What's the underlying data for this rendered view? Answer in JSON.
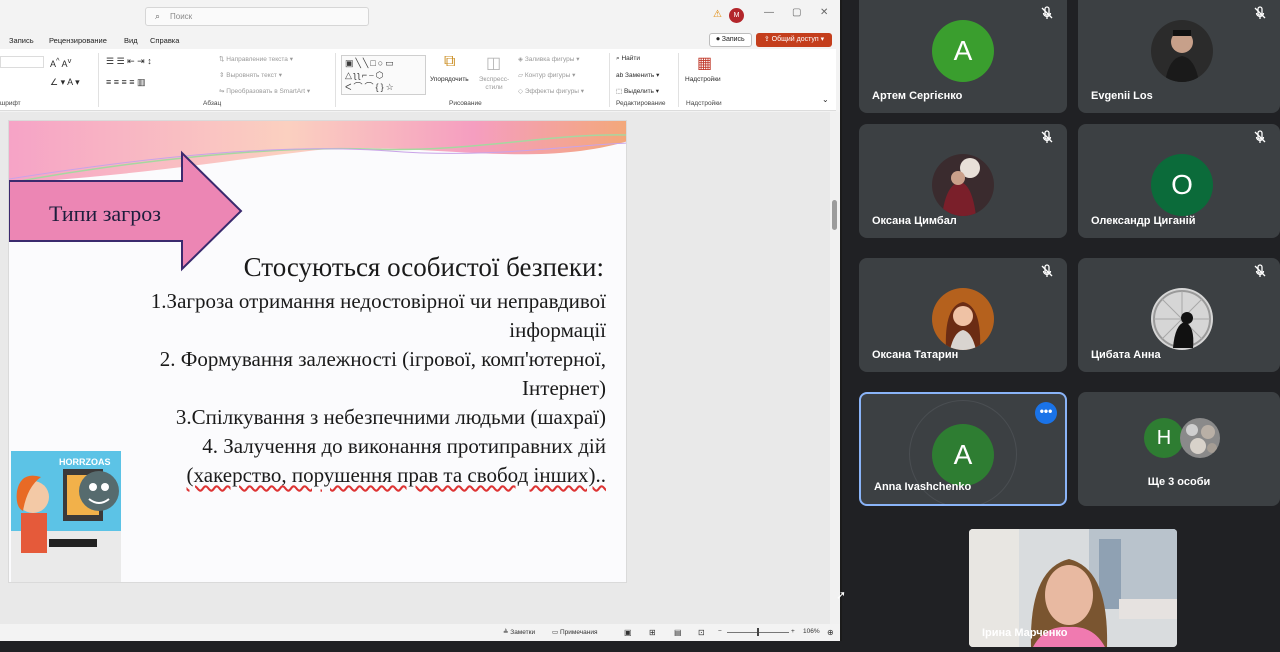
{
  "ppt": {
    "search_placeholder": "Поиск",
    "user_initial": "M",
    "menu": [
      "Запись",
      "Рецензирование",
      "Вид",
      "Справка"
    ],
    "record_button": "Запись",
    "share_button": "Общий доступ",
    "ribbon": {
      "text_direction": "Направление текста",
      "align_text": "Выровнять текст",
      "smartart": "Преобразовать в SmartArt",
      "paragraph_group": "Абзац",
      "font_group": "шрифт",
      "arrange": "Упорядочить",
      "quick_styles": "Экспресс-стили",
      "shape_fill": "Заливка фигуры",
      "shape_outline": "Контур фигуры",
      "shape_effects": "Эффекты фигуры",
      "drawing_group": "Рисование",
      "find": "Найти",
      "replace": "Заменить",
      "select": "Выделить",
      "editing_group": "Редактирование",
      "addins": "Надстройки",
      "addins_group": "Надстройки"
    },
    "slide": {
      "arrow_label": "Типи загроз",
      "heading": "Стосуються особистої безпеки:",
      "lines": [
        "1.Загроза отримання недостовірної чи неправдивої",
        "інформації",
        "2. Формування залежності (ігрової, комп'ютерної,",
        "Інтернет)",
        "3.Спілкування з небезпечними людьми (шахраї)",
        "4. Залучення до виконання протиправних дій",
        "(хакерство, порушення прав та  свобод інших).."
      ],
      "clipart_caption": "HORRZOAS"
    },
    "status": {
      "notes": "Заметки",
      "comments": "Примечания",
      "zoom": "106%"
    }
  },
  "meet": {
    "participants": [
      {
        "name": "Артем Сергієнко",
        "initial": "А",
        "avatar_color": "#33a02c",
        "kind": "letter"
      },
      {
        "name": "Evgenii Los",
        "kind": "photo"
      },
      {
        "name": "Оксана Цимбал",
        "kind": "photo"
      },
      {
        "name": "Олександр Циганій",
        "initial": "О",
        "avatar_color": "#0b6b3a",
        "kind": "letter"
      },
      {
        "name": "Оксана Татарин",
        "kind": "photo"
      },
      {
        "name": "Цибата Анна",
        "kind": "photo"
      },
      {
        "name": "Anna Ivashchenko",
        "initial": "A",
        "avatar_color": "#2e7d32",
        "kind": "letter",
        "speaking": true
      }
    ],
    "others": {
      "label": "Ще 3 особи",
      "initial": "Н",
      "avatar_color": "#2e7d32"
    },
    "self_name": "Ірина Марченко"
  }
}
